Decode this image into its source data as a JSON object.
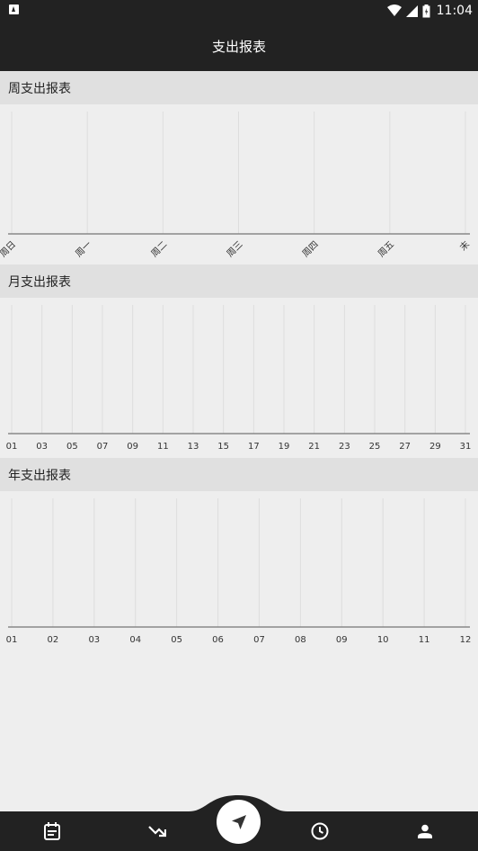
{
  "status_bar": {
    "time": "11:04",
    "battery_label": "battery"
  },
  "app_bar": {
    "title": "支出报表"
  },
  "sections": {
    "weekly": {
      "title": "周支出报表"
    },
    "monthly": {
      "title": "月支出报表"
    },
    "yearly": {
      "title": "年支出报表"
    }
  },
  "chart_data": [
    {
      "type": "line",
      "title": "周支出报表",
      "categories": [
        "周日",
        "周一",
        "周二",
        "周三",
        "周四",
        "周五",
        "末"
      ],
      "series": [],
      "tick_label_rotation": "-45deg",
      "grid": "vertical"
    },
    {
      "type": "line",
      "title": "月支出报表",
      "categories": [
        "01",
        "03",
        "05",
        "07",
        "09",
        "11",
        "13",
        "15",
        "17",
        "19",
        "21",
        "23",
        "25",
        "27",
        "29",
        "31"
      ],
      "series": [],
      "grid": "vertical"
    },
    {
      "type": "line",
      "title": "年支出报表",
      "categories": [
        "01",
        "02",
        "03",
        "04",
        "05",
        "06",
        "07",
        "08",
        "09",
        "10",
        "11",
        "12"
      ],
      "series": [],
      "grid": "vertical"
    }
  ],
  "bottom_nav": {
    "items": [
      {
        "icon": "calendar-icon"
      },
      {
        "icon": "trend-down-icon"
      },
      {
        "icon": "navigation-arrow-icon"
      },
      {
        "icon": "clock-icon"
      },
      {
        "icon": "person-icon"
      }
    ]
  },
  "colors": {
    "bar_bg": "#222222",
    "page_bg": "#eeeeee",
    "section_bg": "#e0e0e0",
    "grid": "#dddddd",
    "axis": "#888888"
  }
}
